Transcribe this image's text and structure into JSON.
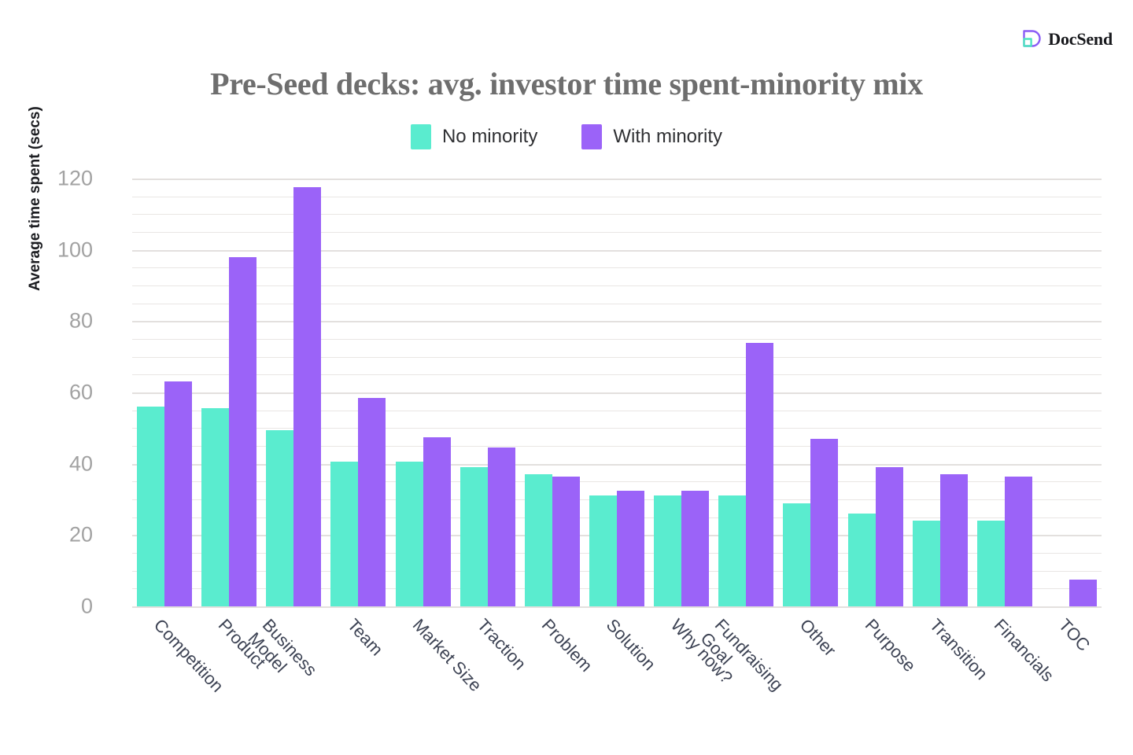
{
  "brand": {
    "name": "DocSend",
    "logo_icon": "docsend-shield-icon",
    "purple": "#8b5cf6",
    "teal": "#4fe3c1"
  },
  "chart_data": {
    "type": "bar",
    "title": "Pre-Seed decks: avg. investor time spent-minority mix",
    "xlabel": "",
    "ylabel": "Average time spent (secs)",
    "ylim": [
      0,
      120
    ],
    "yticks": [
      0,
      20,
      40,
      60,
      80,
      100,
      120
    ],
    "ytick_labels": [
      "0",
      "20",
      "40",
      "60",
      "80",
      "100",
      "120"
    ],
    "minor_tick_step": 5,
    "grid": true,
    "legend_position": "top-center",
    "colors": {
      "No minority": "#5aeccf",
      "With minority": "#9b63f8"
    },
    "categories": [
      "Competition",
      "Product",
      "Business Model",
      "Team",
      "Market Size",
      "Traction",
      "Problem",
      "Solution",
      "Why now?",
      "Fundraising Goal",
      "Other",
      "Purpose",
      "Transition",
      "Financials",
      "TOC"
    ],
    "category_lines": [
      [
        "Competition"
      ],
      [
        "Product"
      ],
      [
        "Business",
        "Model"
      ],
      [
        "Team"
      ],
      [
        "Market Size"
      ],
      [
        "Traction"
      ],
      [
        "Problem"
      ],
      [
        "Solution"
      ],
      [
        "Why now?"
      ],
      [
        "Fundraising",
        "Goal"
      ],
      [
        "Other"
      ],
      [
        "Purpose"
      ],
      [
        "Transition"
      ],
      [
        "Financials"
      ],
      [
        "TOC"
      ]
    ],
    "series": [
      {
        "name": "No minority",
        "color": "#5aeccf",
        "values": [
          56,
          55.5,
          49.5,
          40.5,
          40.5,
          39,
          37,
          31,
          31,
          31,
          29,
          26,
          24,
          24,
          0
        ]
      },
      {
        "name": "With minority",
        "color": "#9b63f8",
        "values": [
          63,
          98,
          117.5,
          58.5,
          47.5,
          44.5,
          36.5,
          32.5,
          32.5,
          74,
          47,
          39,
          37,
          36.5,
          7.5
        ]
      }
    ]
  },
  "legend": {
    "items": [
      {
        "label": "No minority",
        "color": "#5aeccf"
      },
      {
        "label": "With minority",
        "color": "#9b63f8"
      }
    ]
  }
}
